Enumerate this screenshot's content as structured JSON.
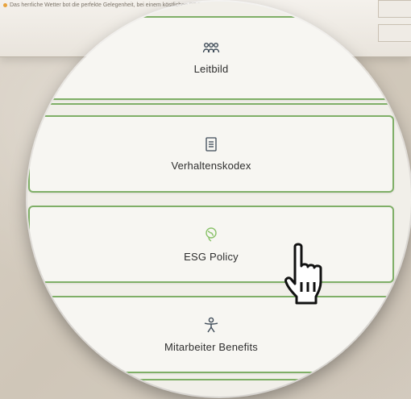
{
  "background": {
    "notice_text": "Das herrliche Wetter bot die perfekte Gelegenheit, bei einem köstlichen BBQ zu entspannen"
  },
  "tiles": [
    {
      "label": "Leitbild",
      "icon": "people-icon"
    },
    {
      "label": "Verhaltenskodex",
      "icon": "document-icon"
    },
    {
      "label": "ESG Policy",
      "icon": "globe-icon"
    },
    {
      "label": "Mitarbeiter Benefits",
      "icon": "person-icon"
    }
  ],
  "colors": {
    "tile_border": "#7faf67",
    "icon": "#3d4a57",
    "esg_icon": "#8ac26a"
  }
}
